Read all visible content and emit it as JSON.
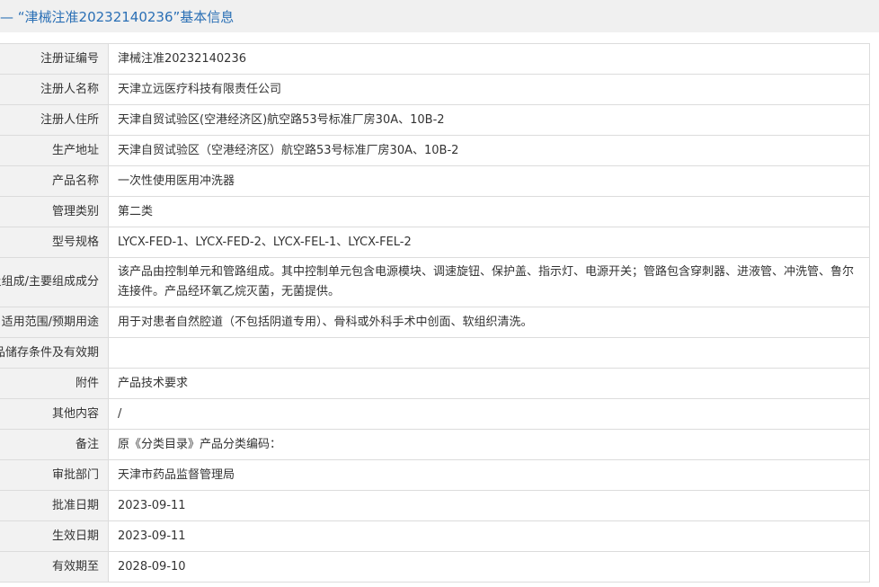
{
  "header": {
    "title": "— “津械注准20232140236”基本信息"
  },
  "rows": [
    {
      "label": "注册证编号",
      "value": "津械注准20232140236"
    },
    {
      "label": "注册人名称",
      "value": "天津立远医疗科技有限责任公司"
    },
    {
      "label": "注册人住所",
      "value": "天津自贸试验区(空港经济区)航空路53号标准厂房30A、10B-2"
    },
    {
      "label": "生产地址",
      "value": "天津自贸试验区（空港经济区）航空路53号标准厂房30A、10B-2"
    },
    {
      "label": "产品名称",
      "value": "一次性使用医用冲洗器"
    },
    {
      "label": "管理类别",
      "value": "第二类"
    },
    {
      "label": "型号规格",
      "value": "LYCX-FED-1、LYCX-FED-2、LYCX-FEL-1、LYCX-FEL-2"
    },
    {
      "label": "结构及组成/主要组成成分",
      "value": "该产品由控制单元和管路组成。其中控制单元包含电源模块、调速旋钮、保护盖、指示灯、电源开关；管路包含穿刺器、进液管、冲洗管、鲁尔连接件。产品经环氧乙烷灭菌，无菌提供。"
    },
    {
      "label": "适用范围/预期用途",
      "value": "用于对患者自然腔道（不包括阴道专用）、骨科或外科手术中创面、软组织清洗。"
    },
    {
      "label": "产品储存条件及有效期",
      "value": ""
    },
    {
      "label": "附件",
      "value": "产品技术要求"
    },
    {
      "label": "其他内容",
      "value": "/"
    },
    {
      "label": "备注",
      "value": "原《分类目录》产品分类编码："
    },
    {
      "label": "审批部门",
      "value": "天津市药品监督管理局"
    },
    {
      "label": "批准日期",
      "value": "2023-09-11"
    },
    {
      "label": "生效日期",
      "value": "2023-09-11"
    },
    {
      "label": "有效期至",
      "value": "2028-09-10"
    }
  ]
}
